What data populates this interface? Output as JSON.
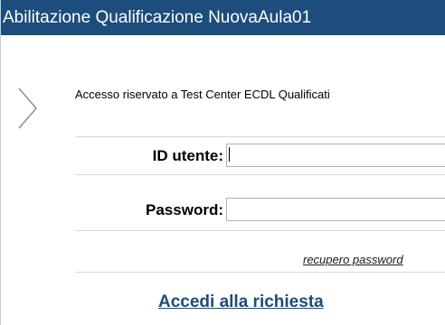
{
  "header": {
    "title": "Abilitazione Qualificazione NuovaAula01"
  },
  "notice": {
    "text": "Accesso riservato a Test Center ECDL Qualificati"
  },
  "form": {
    "user_id_label": "ID utente:",
    "password_label": "Password:",
    "user_id_value": "",
    "password_value": "",
    "recover_link": "recupero password",
    "submit_label": "Accedi alla richiesta"
  },
  "icons": {
    "arrow": "chevron-right-icon"
  },
  "colors": {
    "header_bg": "#1c4d7c",
    "header_text": "#ffffff",
    "link": "#1c4d7c"
  }
}
